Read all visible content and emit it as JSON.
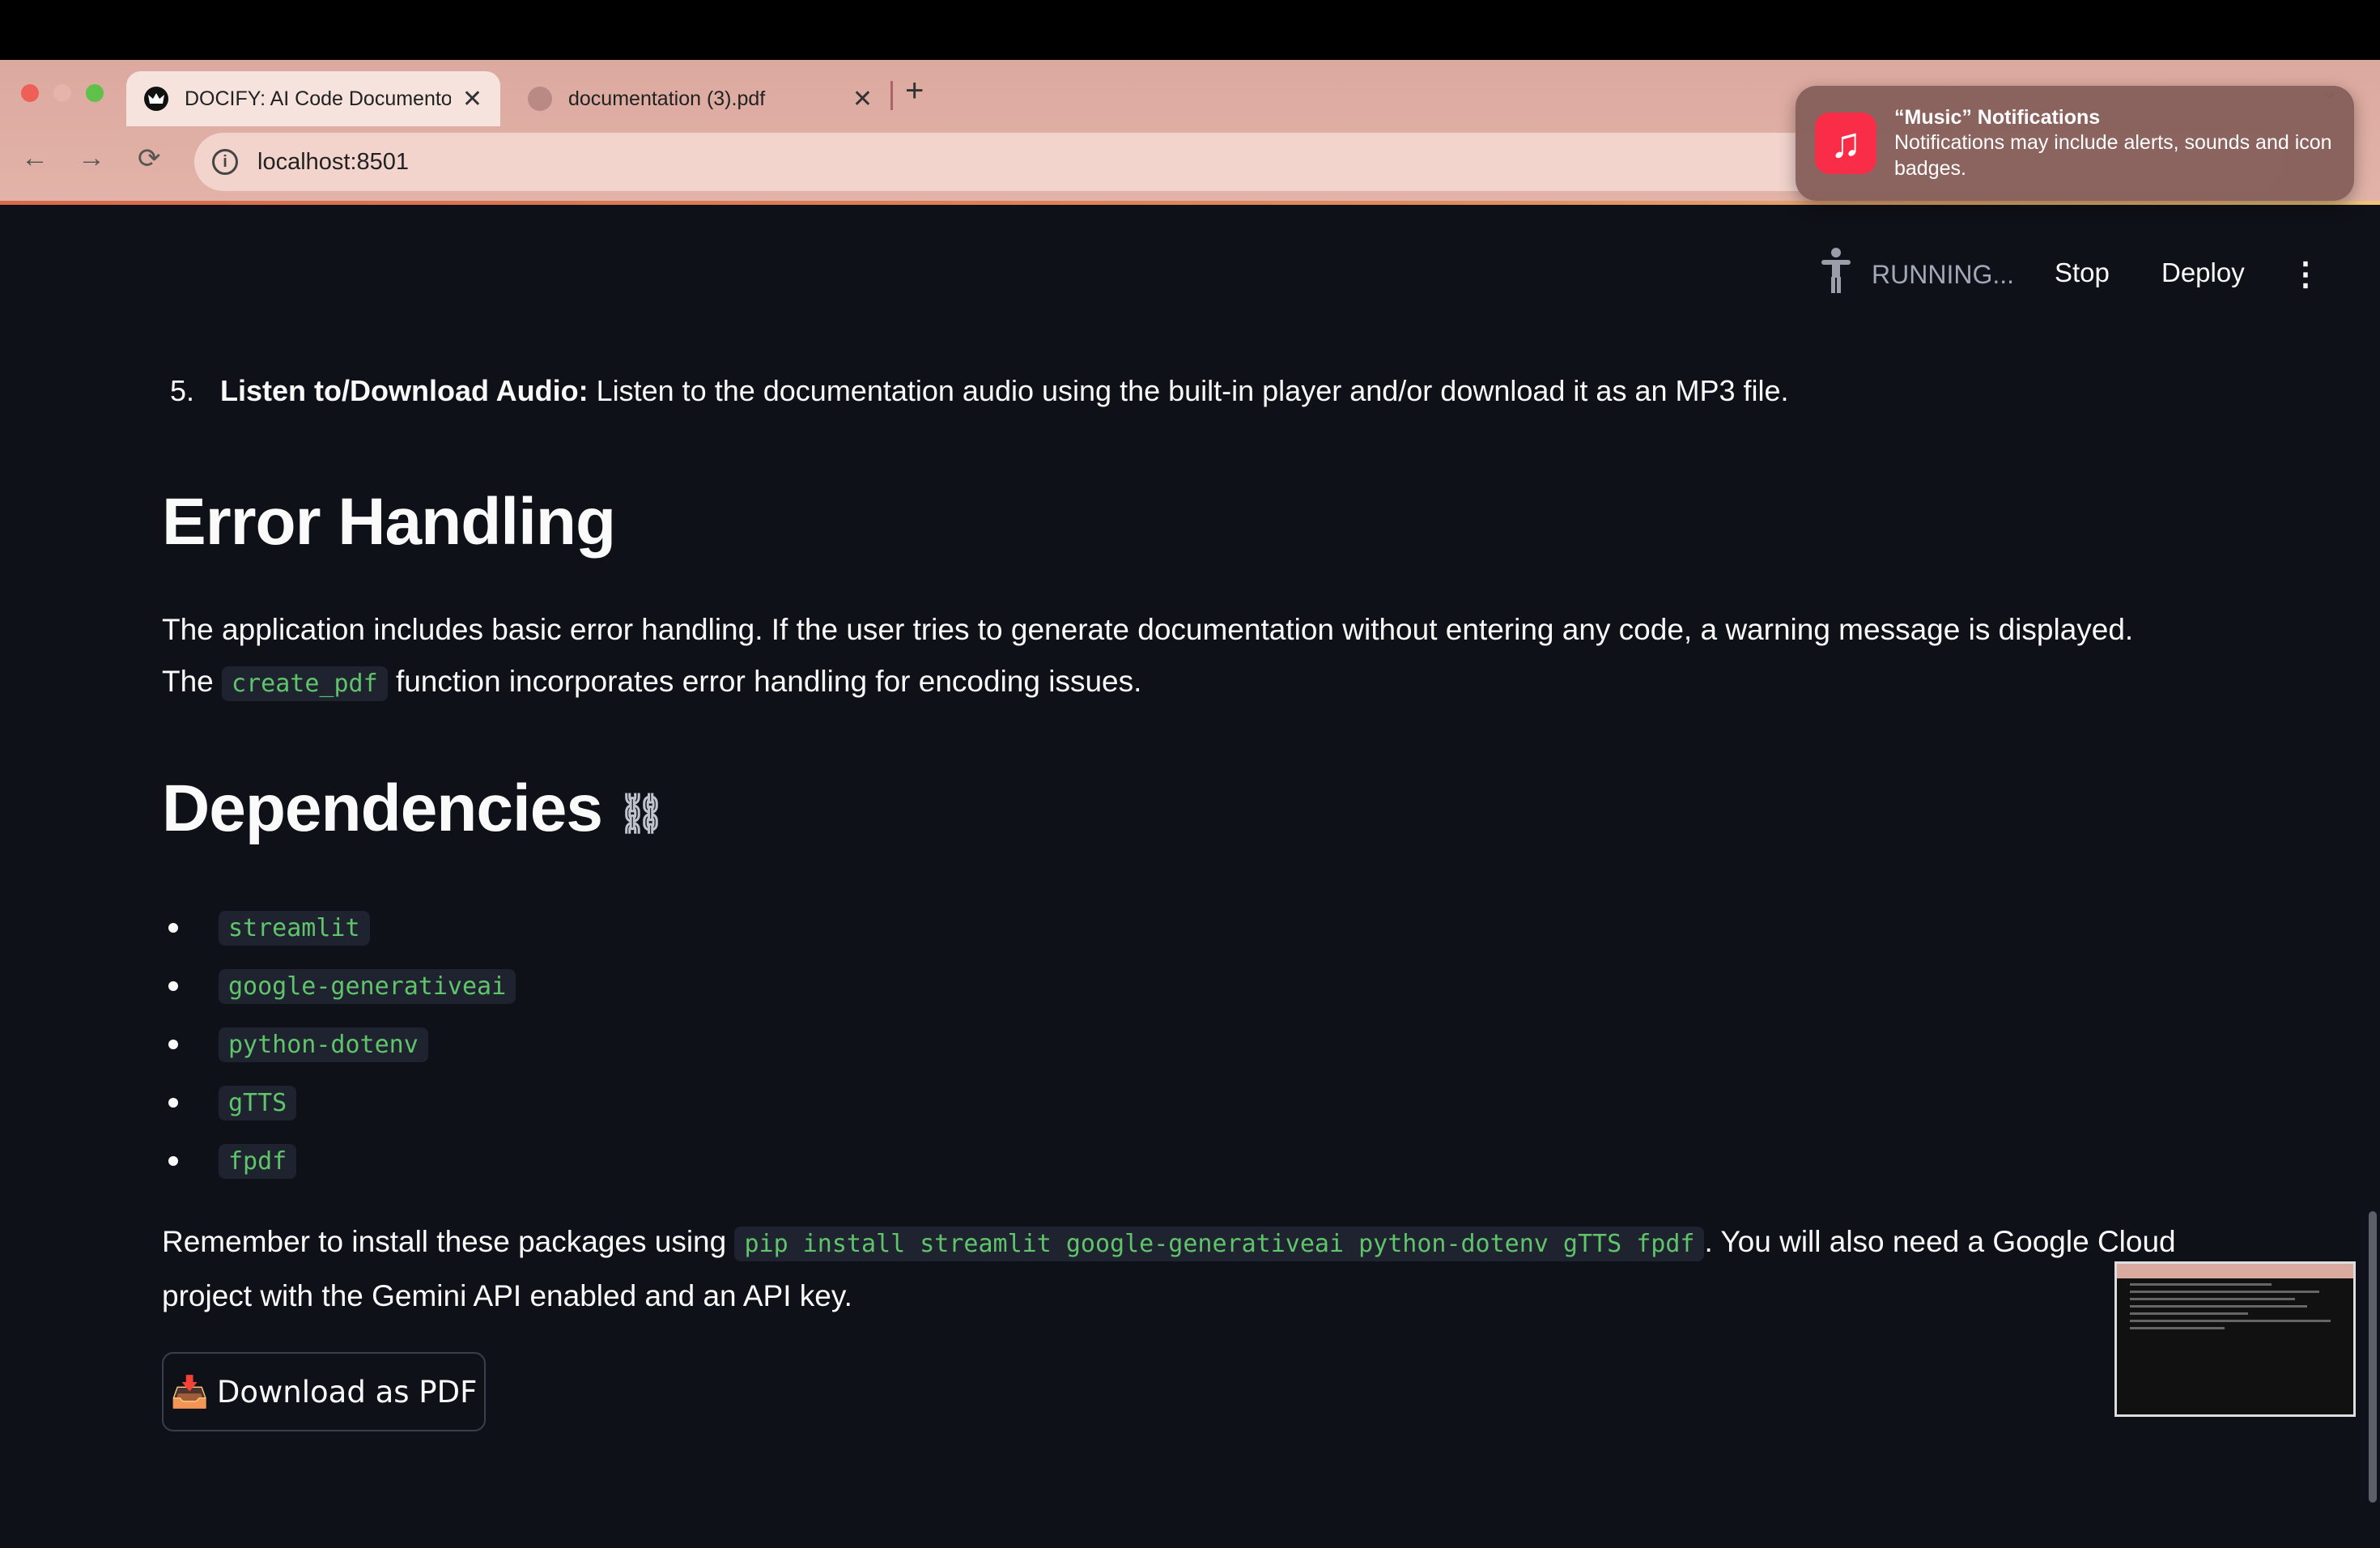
{
  "browser": {
    "tabs": [
      {
        "title": "DOCIFY: AI Code Documento",
        "close": "✕"
      },
      {
        "title": "documentation (3).pdf",
        "close": "✕"
      }
    ],
    "new_tab": "+",
    "url": "localhost:8501",
    "back_icon": "←",
    "forward_icon": "→",
    "reload_icon": "⟳"
  },
  "notification": {
    "title": "“Music” Notifications",
    "body": "Notifications may include alerts, sounds and icon badges.",
    "icon": "♫"
  },
  "toolbar": {
    "status": "RUNNING...",
    "stop": "Stop",
    "deploy": "Deploy",
    "menu": "⋮"
  },
  "doc": {
    "step5": {
      "number": "5.",
      "label": "Listen to/Download Audio:",
      "text": " Listen to the documentation audio using the built-in player and/or download it as an MP3 file."
    },
    "error_heading": "Error Handling",
    "error_text_1": "The application includes basic error handling. If the user tries to generate documentation without entering any code, a warning message is displayed.",
    "error_text_2_pre": "The ",
    "error_text_2_code": "create_pdf",
    "error_text_2_post": " function incorporates error handling for encoding issues.",
    "deps_heading": "Dependencies",
    "link_icon": "⛓",
    "dependencies": [
      "streamlit",
      "google-generativeai",
      "python-dotenv",
      "gTTS",
      "fpdf"
    ],
    "install_pre": "Remember to install these packages using ",
    "install_code": "pip install streamlit google-generativeai python-dotenv gTTS fpdf",
    "install_post": ". You will also need a Google Cloud",
    "install_line2": "project with the Gemini API enabled and an API key.",
    "download_button": "Download as PDF",
    "download_icon": "📥"
  }
}
